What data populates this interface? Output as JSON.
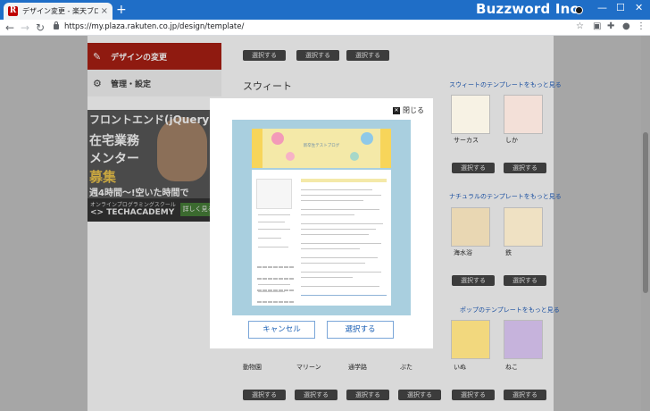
{
  "browser": {
    "tab_title": "デザイン変更 - 楽天ブログ",
    "favicon_letter": "R",
    "brand": "Buzzword Inc.",
    "url": "https://my.plaza.rakuten.co.jp/design/template/",
    "new_tab": "+",
    "tab_close": "×",
    "minimize": "—",
    "maximize": "☐",
    "close": "✕"
  },
  "sidebar": {
    "items": [
      {
        "label": "デザインの変更",
        "icon": "paint-icon"
      },
      {
        "label": "管理・設定",
        "icon": "gear-icon"
      }
    ]
  },
  "ad": {
    "line1": "フロントエンド(jQuery",
    "line2": "在宅業務",
    "line3": "メンター",
    "line4": "募集",
    "line5": "週4時間〜!空いた時間で",
    "small": "オンラインプログラミングスクール",
    "logo": "<> TECHACADEMY",
    "button": "詳しく見る"
  },
  "content": {
    "select_label": "選択する",
    "sections": [
      {
        "title": "スウィート",
        "more": "スウィートのテンプレートをもっと見る"
      },
      {
        "more": "ナチュラルのテンプレートをもっと見る"
      },
      {
        "more": "ポップのテンプレートをもっと見る"
      }
    ],
    "thumb_labels": [
      "サーカス",
      "しか",
      "海水浴",
      "鉄",
      "動物園",
      "マリーン",
      "通学路",
      "ぶた",
      "いぬ",
      "ねこ"
    ]
  },
  "modal": {
    "close_label": "閉じる",
    "preview_title": "新卒生テストブログ",
    "cancel": "キャンセル",
    "select": "選択する"
  },
  "colors": {
    "tab_bar": "#1f6ec7",
    "overlay": "#a6a6a6",
    "design_menu": "#8f1a10",
    "link": "#1a4fa0"
  }
}
